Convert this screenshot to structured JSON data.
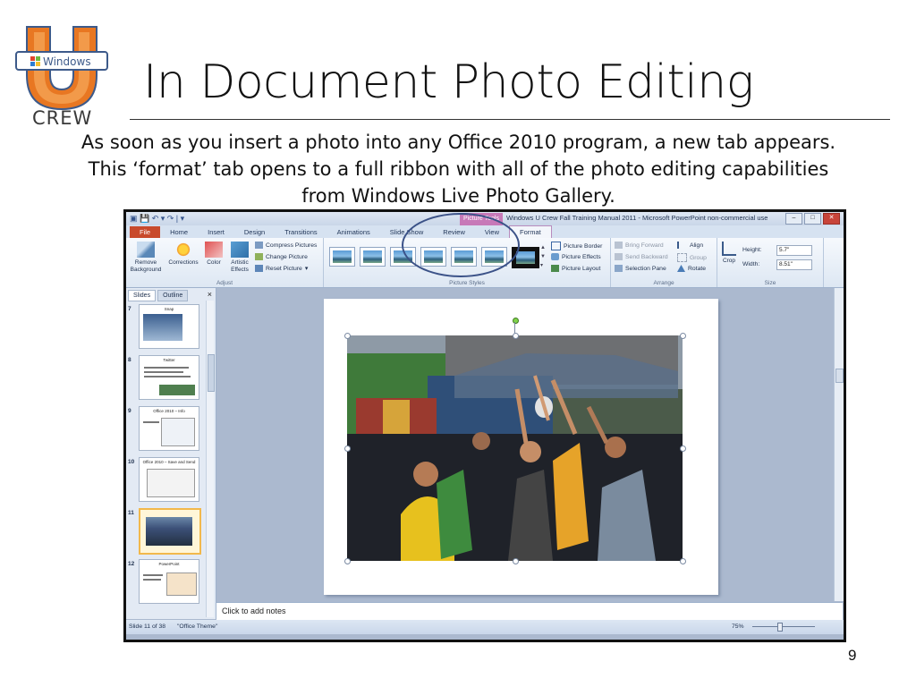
{
  "slide": {
    "title": "In Document Photo Editing",
    "body": "As soon as you insert a photo into any Office 2010 program, a new tab appears.  This ‘format’ tab opens to a full ribbon with all of the photo editing capabilities from Windows Live Photo Gallery.",
    "page_number": "9",
    "logo_badge": "Windows",
    "logo_crew": "CREW"
  },
  "screenshot": {
    "window_title": "Windows U Crew Fall Training Manual 2011 - Microsoft PowerPoint non-commercial use",
    "contextual_tab": "Picture Tools",
    "tabs": [
      "File",
      "Home",
      "Insert",
      "Design",
      "Transitions",
      "Animations",
      "Slide Show",
      "Review",
      "View",
      "Format"
    ],
    "groups": {
      "adjust": {
        "label": "Adjust",
        "remove_background": "Remove Background",
        "corrections": "Corrections",
        "color": "Color",
        "artistic_effects": "Artistic Effects",
        "compress": "Compress Pictures",
        "change": "Change Picture",
        "reset": "Reset Picture"
      },
      "styles": {
        "label": "Picture Styles",
        "border": "Picture Border",
        "effects": "Picture Effects",
        "layout": "Picture Layout"
      },
      "arrange": {
        "label": "Arrange",
        "bring_forward": "Bring Forward",
        "send_backward": "Send Backward",
        "selection_pane": "Selection Pane",
        "align": "Align",
        "group": "Group",
        "rotate": "Rotate"
      },
      "size": {
        "label": "Size",
        "crop": "Crop",
        "height_label": "Height:",
        "height_value": "5.7\"",
        "width_label": "Width:",
        "width_value": "8.51\""
      }
    },
    "pane": {
      "tab_slides": "Slides",
      "tab_outline": "Outline",
      "close": "×",
      "thumbnails": [
        {
          "num": "7",
          "title": "Snap"
        },
        {
          "num": "8",
          "title": "Twitter"
        },
        {
          "num": "9",
          "title": "Office 2010 – Info"
        },
        {
          "num": "10",
          "title": "Office 2010 – Save and Send"
        },
        {
          "num": "11",
          "title": ""
        },
        {
          "num": "12",
          "title": "PowerPoint"
        }
      ]
    },
    "notes_placeholder": "Click to add notes",
    "status": {
      "slide_of": "Slide 11 of 38",
      "theme": "\"Office Theme\"",
      "zoom": "75%"
    },
    "colors": {
      "file_tab": "#c84a2c",
      "contextual": "#c779b8",
      "ribbon": "#dde7f3",
      "highlight_circle": "#3b5288"
    }
  }
}
